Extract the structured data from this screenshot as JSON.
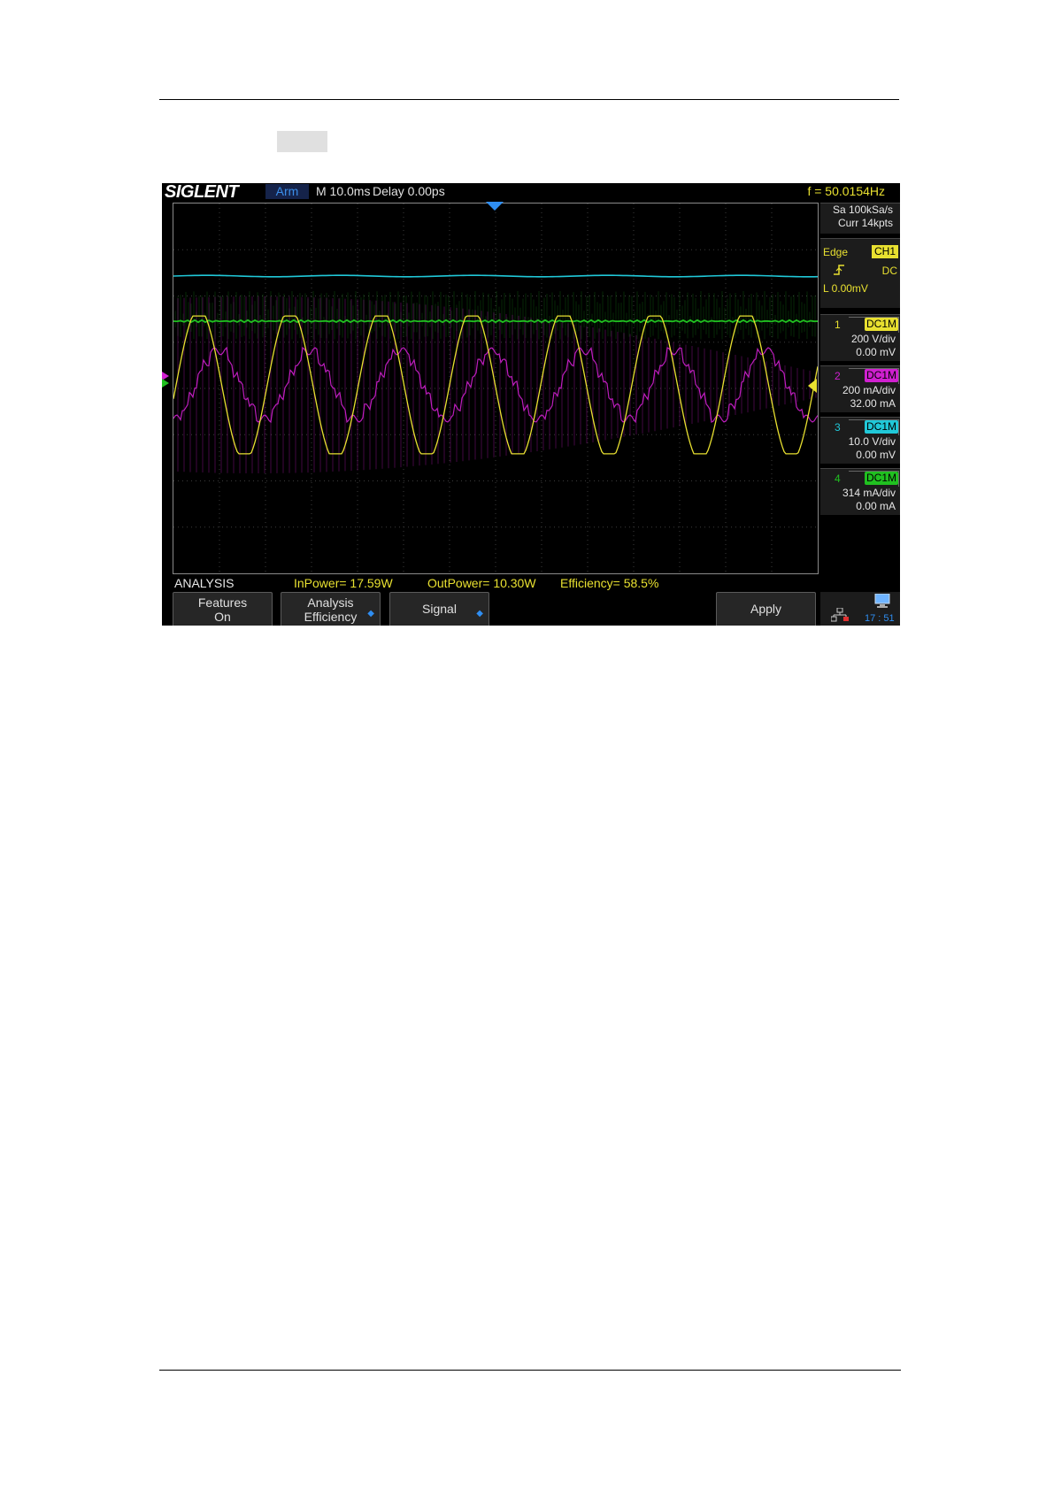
{
  "scope": {
    "brand": "SIGLENT",
    "run_state": "Arm",
    "timebase": "M 10.0ms",
    "delay": "Delay 0.00ps",
    "frequency": "f = 50.0154Hz",
    "sample_rate": "Sa 100kSa/s",
    "memory_depth": "Curr 14kpts",
    "trigger": {
      "type": "Edge",
      "source": "CH1",
      "coupling": "DC",
      "level": "L  0.00mV"
    },
    "channels": [
      {
        "num": "1",
        "coupling": "DC1M",
        "scale": "200 V/div",
        "offset": "0.00 mV",
        "color": "#e8e030"
      },
      {
        "num": "2",
        "coupling": "DC1M",
        "scale": "200 mA/div",
        "offset": "32.00 mA",
        "color": "#d020d0"
      },
      {
        "num": "3",
        "coupling": "DC1M",
        "scale": "10.0 V/div",
        "offset": "0.00 mV",
        "color": "#20c8d8"
      },
      {
        "num": "4",
        "coupling": "DC1M",
        "scale": "314 mA/div",
        "offset": "0.00 mA",
        "color": "#20c020"
      }
    ],
    "analysis": {
      "label": "ANALYSIS",
      "in_power": "InPower= 17.59W",
      "out_power": "OutPower= 10.30W",
      "efficiency": "Efficiency= 58.5%"
    },
    "softkeys": {
      "features_l1": "Features",
      "features_l2": "On",
      "analysis_l1": "Analysis",
      "analysis_l2": "Efficiency",
      "signal": "Signal",
      "apply": "Apply"
    },
    "clock": "17 : 51",
    "icons": [
      "network-icon",
      "computer-icon"
    ]
  }
}
